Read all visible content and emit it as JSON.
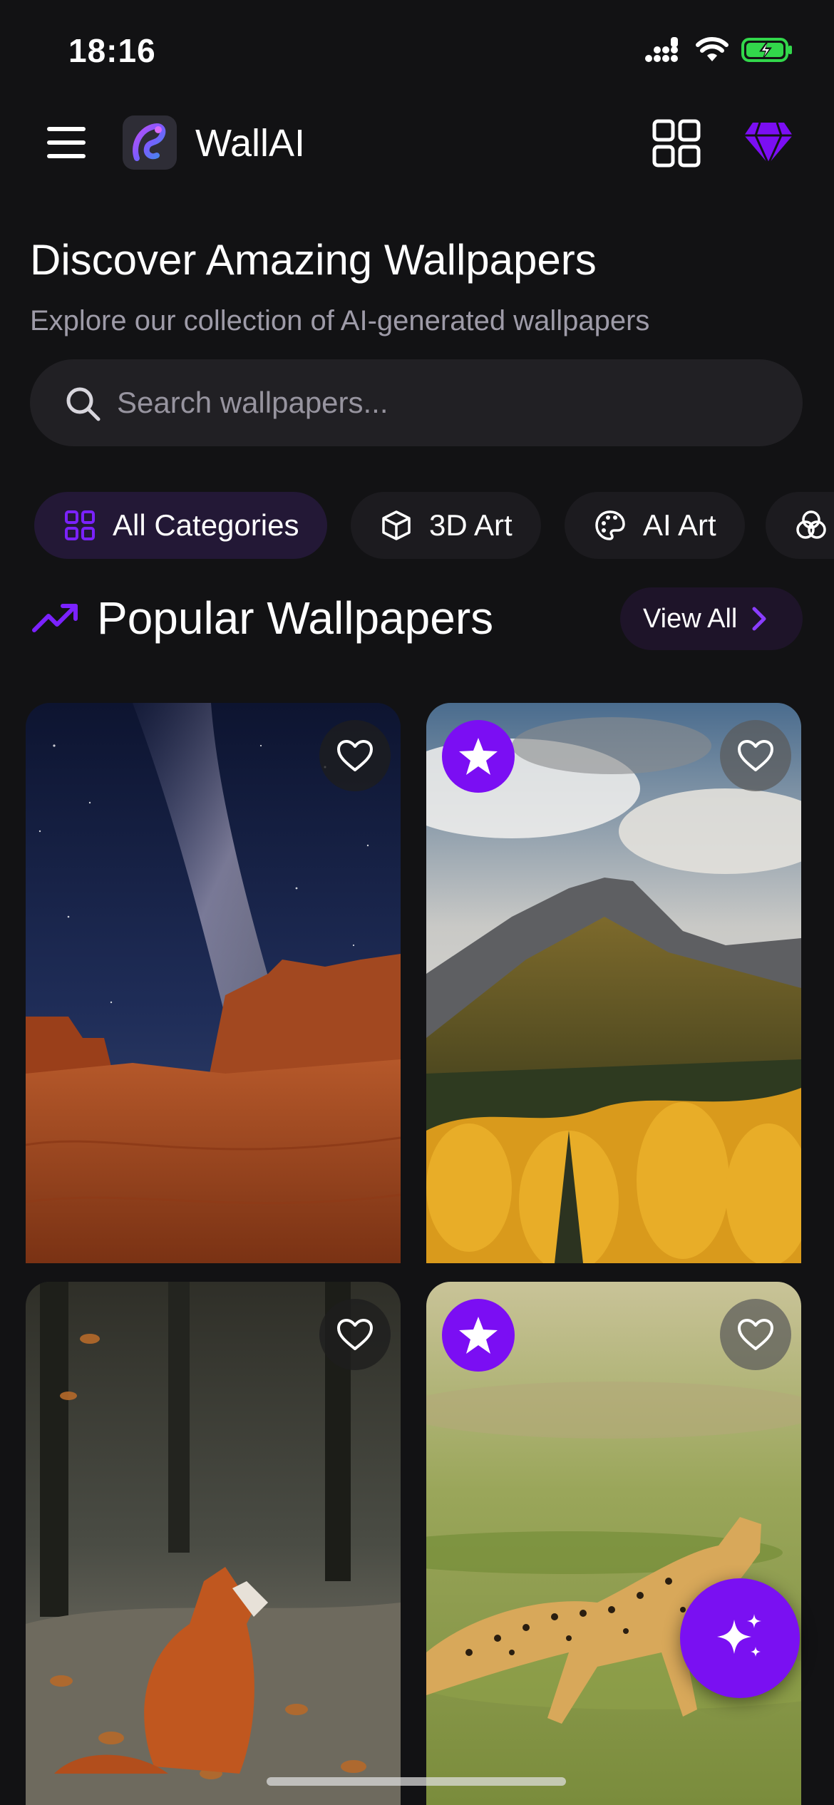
{
  "status_bar": {
    "time": "18:16"
  },
  "header": {
    "app_name": "WallAI"
  },
  "hero": {
    "title": "Discover Amazing Wallpapers",
    "subtitle": "Explore our collection of AI-generated wallpapers"
  },
  "search": {
    "placeholder": "Search wallpapers..."
  },
  "categories": [
    {
      "label": "All Categories",
      "icon": "grid-icon",
      "active": true
    },
    {
      "label": "3D Art",
      "icon": "cube-icon",
      "active": false
    },
    {
      "label": "AI Art",
      "icon": "palette-icon",
      "active": false
    },
    {
      "label": "",
      "icon": "circles-icon",
      "active": false
    }
  ],
  "section": {
    "title": "Popular Wallpapers",
    "view_all_label": "View All"
  },
  "wallpapers": [
    {
      "subject": "desert canyon under milky way",
      "premium": false
    },
    {
      "subject": "autumn mountain forest",
      "premium": true
    },
    {
      "subject": "red fox in autumn leaves",
      "premium": false
    },
    {
      "subject": "running cheetah",
      "premium": true
    }
  ],
  "colors": {
    "background": "#121214",
    "accent": "#7b0ef3",
    "chip_active": "#231836",
    "surface": "#212024",
    "muted_text": "#9e9ba8"
  }
}
